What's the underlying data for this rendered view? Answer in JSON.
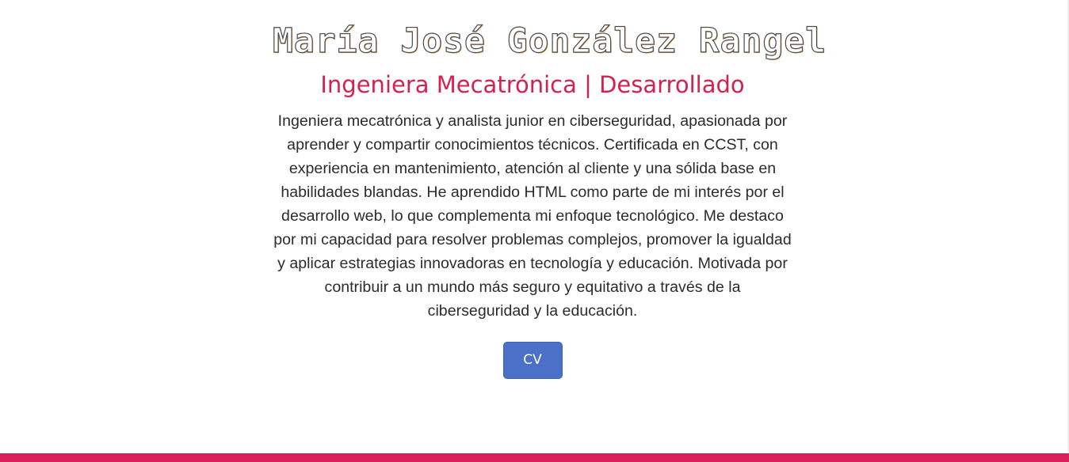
{
  "hero": {
    "name": "María José González Rangel",
    "role": "Ingeniera Mecatrónica | Desarrollado",
    "bio": "Ingeniera mecatrónica y analista junior en ciberseguridad, apasionada por aprender y compartir conocimientos técnicos. Certificada en CCST, con experiencia en mantenimiento, atención al cliente y una sólida base en habilidades blandas. He aprendido HTML como parte de mi interés por el desarrollo web, lo que complementa mi enfoque tecnológico. Me destaco por mi capacidad para resolver problemas complejos, promover la igualdad y aplicar estrategias innovadoras en tecnología y educación. Motivada por contribuir a un mundo más seguro y equitativo a través de la ciberseguridad y la educación.",
    "cv_label": "CV"
  },
  "colors": {
    "role": "#d6204e",
    "button": "#4a70c8",
    "footer": "#d81f5a",
    "text": "#2b2b2b"
  }
}
